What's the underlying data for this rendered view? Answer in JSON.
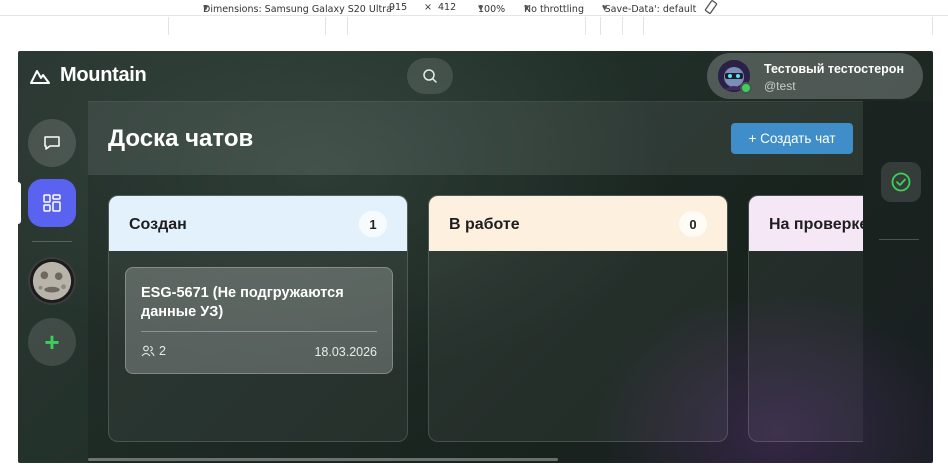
{
  "devtools": {
    "device": "Dimensions: Samsung Galaxy S20 Ultra",
    "width": "915",
    "times": "×",
    "height": "412",
    "zoom": "100%",
    "throttling": "No throttling",
    "save_data": "'Save-Data': default"
  },
  "app": {
    "logo_text": "Mountain",
    "logo_icon": "mountain-icon",
    "search_icon": "search-icon"
  },
  "user": {
    "name": "Тестовый тестостерон",
    "handle": "@test",
    "status_color": "#3ecf5b"
  },
  "board": {
    "title": "Доска чатов",
    "create_button": "+ Создать чат",
    "accent": "#3f8ec9"
  },
  "columns": [
    {
      "title": "Создан",
      "count": "1",
      "color": "#e3f1fc",
      "cards": [
        {
          "title": "ESG-5671 (Не подгружаются данные УЗ)",
          "members": "2",
          "date": "18.03.2026"
        }
      ]
    },
    {
      "title": "В работе",
      "count": "0",
      "color": "#fdf0de",
      "cards": []
    },
    {
      "title": "На проверке",
      "count": "",
      "color": "#f6e7f7",
      "cards": []
    }
  ],
  "rail": {
    "chat_icon": "chat-bubble-icon",
    "board_icon": "grid-icon",
    "add_label": "+"
  }
}
